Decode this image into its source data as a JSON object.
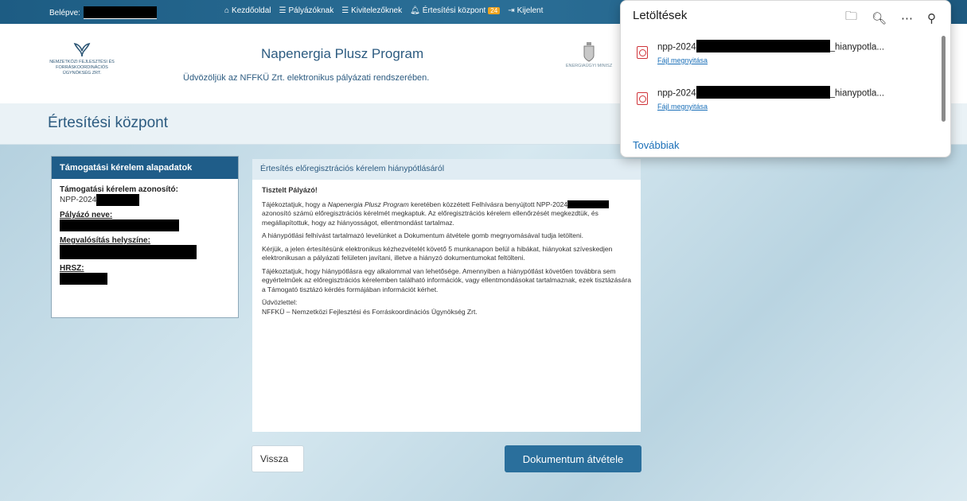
{
  "nav": {
    "login_label": "Belépve:",
    "links": [
      {
        "icon": "home-icon",
        "label": "Kezdőoldal"
      },
      {
        "icon": "list-icon",
        "label": "Pályázóknak"
      },
      {
        "icon": "list-icon",
        "label": "Kivitelezőknek"
      },
      {
        "icon": "bell-icon",
        "label": "Értesítési központ",
        "badge": "24"
      },
      {
        "icon": "logout-icon",
        "label": "Kijelent"
      }
    ]
  },
  "header": {
    "logo_text": "NEMZETKÖZI FEJLESZTÉSI ÉS FORRÁSKOORDINÁCIÓS ÜGYNÖKSÉG ZRT.",
    "title": "Napenergia Plusz Program",
    "welcome": "Üdvözöljük az NFFKÜ Zrt. elektronikus pályázati rendszerében.",
    "ministry": "ENERGIAÜGYI MINISZ"
  },
  "page_title": "Értesítési központ",
  "left_panel": {
    "title": "Támogatási kérelem alapadatok",
    "id_label": "Támogatási kérelem azonosító:",
    "id_value": "NPP-2024",
    "name_label": "Pályázó neve:",
    "location_label": "Megvalósítás helyszíne:",
    "hrsz_label": "HRSZ:"
  },
  "notice": {
    "title": "Értesítés előregisztrációs kérelem hiánypótlásáról",
    "greeting": "Tisztelt Pályázó!",
    "p1_a": "Tájékoztatjuk, hogy a ",
    "p1_program": "Napenergia Plusz Program",
    "p1_b": " keretében közzétett Felhívásra benyújtott NPP-2024",
    "p1_c": " azonosító számú előregisztrációs kérelmét megkaptuk. Az előregisztrációs kérelem ellenőrzését megkezdtük, és megállapítottuk, hogy az hiányosságot, ellentmondást tartalmaz.",
    "p2": "A hiánypótlási felhívást tartalmazó levelünket a Dokumentum átvétele gomb megnyomásával tudja letölteni.",
    "p3": "Kérjük, a jelen értesítésünk elektronikus kézhezvételét követő 5 munkanapon belül a hibákat, hiányokat szíveskedjen elektronikusan a pályázati felületen javítani, illetve a hiányzó dokumentumokat feltölteni.",
    "p4": "Tájékoztatjuk, hogy hiánypótlásra egy alkalommal van lehetősége. Amennyiben a hiánypótlást követően továbbra sem egyértelműek az előregisztrációs kérelemben található információk, vagy ellentmondásokat tartalmaznak, ezek tisztázására a Támogató tisztázó kérdés formájában információt kérhet.",
    "closing": "Üdvözlettel:",
    "signature": "NFFKÜ – Nemzetközi Fejlesztési és Forráskoordinációs Ügynökség Zrt."
  },
  "buttons": {
    "back": "Vissza",
    "document": "Dokumentum átvétele"
  },
  "downloads": {
    "title": "Letöltések",
    "items": [
      {
        "prefix": "npp-2024",
        "suffix": "_hianypotla...",
        "action": "Fájl megnyitása"
      },
      {
        "prefix": "npp-2024",
        "suffix": "_hianypotla...",
        "action": "Fájl megnyitása"
      }
    ],
    "more": "Továbbiak"
  },
  "colors": {
    "nav_bg": "#1d5c83",
    "accent": "#2a6f9c",
    "link": "#1a6fb8",
    "badge": "#f0a420"
  }
}
